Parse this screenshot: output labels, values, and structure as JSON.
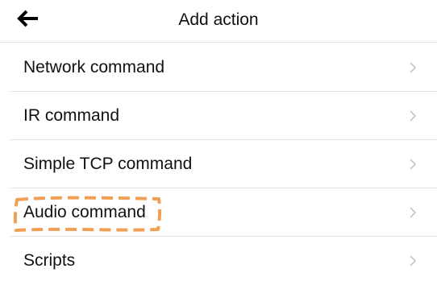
{
  "header": {
    "title": "Add action",
    "back_icon": "arrow-left-icon"
  },
  "list": {
    "items": [
      {
        "label": "Network command",
        "icon": "chevron-right-icon"
      },
      {
        "label": "IR command",
        "icon": "chevron-right-icon"
      },
      {
        "label": "Simple TCP command",
        "icon": "chevron-right-icon"
      },
      {
        "label": "Audio command",
        "icon": "chevron-right-icon",
        "highlighted": true
      },
      {
        "label": "Scripts",
        "icon": "chevron-right-icon"
      }
    ]
  },
  "colors": {
    "divider": "#e3e3e6",
    "chevron": "#c4c4c7",
    "highlight": "#f0a055",
    "text": "#111111"
  }
}
